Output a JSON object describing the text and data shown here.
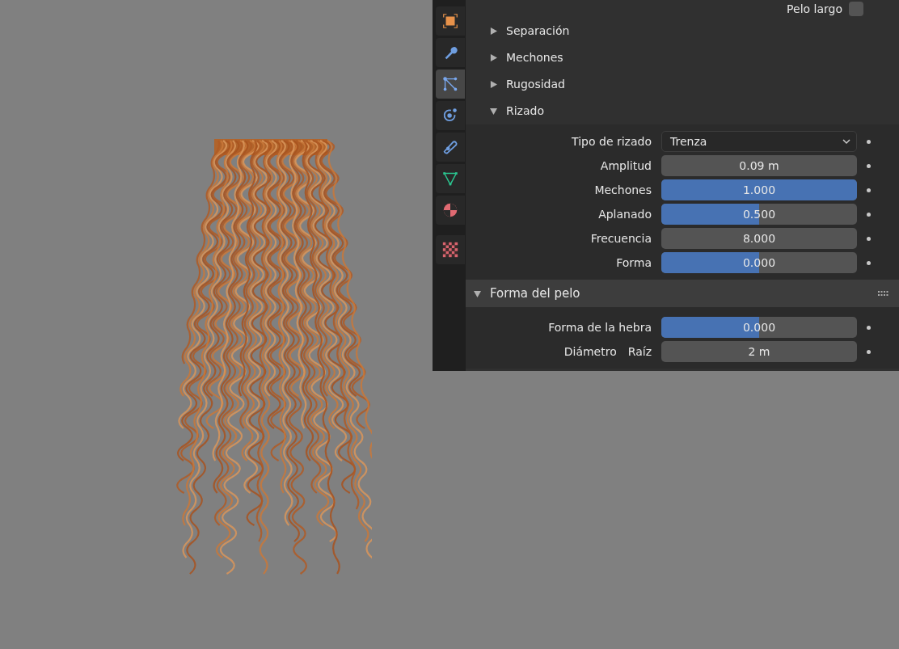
{
  "sidebar_tabs": [
    {
      "selected": false
    },
    {
      "selected": false
    },
    {
      "selected": true
    },
    {
      "selected": false
    },
    {
      "selected": false
    },
    {
      "selected": false
    },
    {
      "selected": false
    },
    {
      "selected": false
    }
  ],
  "top_option": {
    "label": "Pelo largo",
    "checked": false
  },
  "subpanels": [
    {
      "title": "Separación",
      "expanded": false
    },
    {
      "title": "Mechones",
      "expanded": false
    },
    {
      "title": "Rugosidad",
      "expanded": false
    },
    {
      "title": "Rizado",
      "expanded": true,
      "properties": [
        {
          "kind": "dropdown",
          "label": "Tipo de rizado",
          "value": "Trenza"
        },
        {
          "kind": "number",
          "label": "Amplitud",
          "value": "0.09 m"
        },
        {
          "kind": "slider",
          "label": "Mechones",
          "value": "1.000",
          "level": 1
        },
        {
          "kind": "slider",
          "label": "Aplanado",
          "value": "0.500",
          "level": 0.5
        },
        {
          "kind": "number",
          "label": "Frecuencia",
          "value": "8.000"
        },
        {
          "kind": "slider",
          "label": "Forma",
          "value": "0.000",
          "level": 0.5
        }
      ]
    }
  ],
  "panel": {
    "title": "Forma del pelo",
    "expanded": true,
    "properties": [
      {
        "kind": "slider",
        "label": "Forma de la hebra",
        "value": "0.000",
        "level": 0.5
      },
      {
        "kind": "number",
        "label": "Diámetro",
        "sublabel": "Raíz",
        "value": "2 m"
      }
    ]
  }
}
